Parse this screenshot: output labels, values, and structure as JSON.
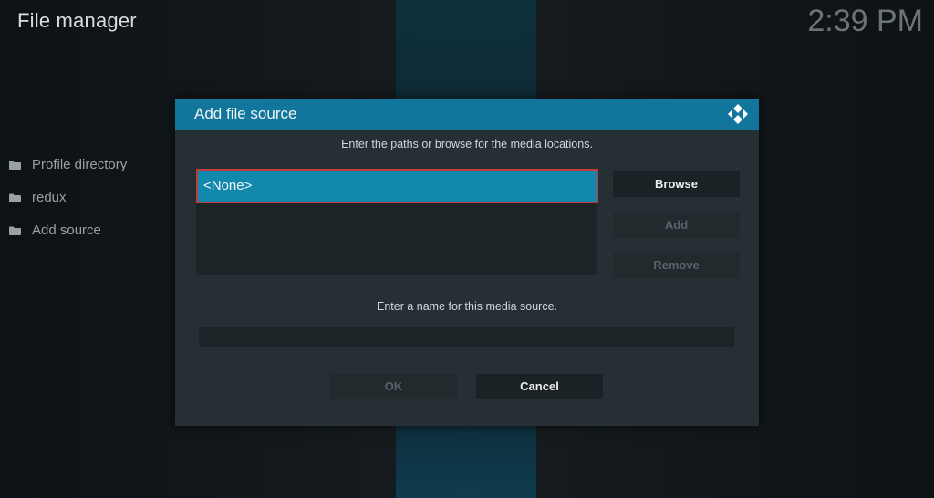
{
  "app": {
    "title": "File manager",
    "clock": "2:39 PM"
  },
  "sidebar": {
    "items": [
      {
        "label": "Profile directory",
        "icon": "folder-icon"
      },
      {
        "label": "redux",
        "icon": "folder-icon"
      },
      {
        "label": "Add source",
        "icon": "folder-icon"
      }
    ]
  },
  "dialog": {
    "title": "Add file source",
    "logo_icon": "kodi-logo-icon",
    "paths_instruction": "Enter the paths or browse for the media locations.",
    "paths": [
      {
        "value": "<None>",
        "selected": true
      }
    ],
    "buttons": {
      "browse": "Browse",
      "add": "Add",
      "remove": "Remove",
      "ok": "OK",
      "cancel": "Cancel"
    },
    "name_instruction": "Enter a name for this media source.",
    "name_value": ""
  },
  "colors": {
    "header": "#12769c",
    "selected_path": "#1388ad",
    "focus_border": "#c23b3b",
    "dialog_bg": "#263034"
  }
}
